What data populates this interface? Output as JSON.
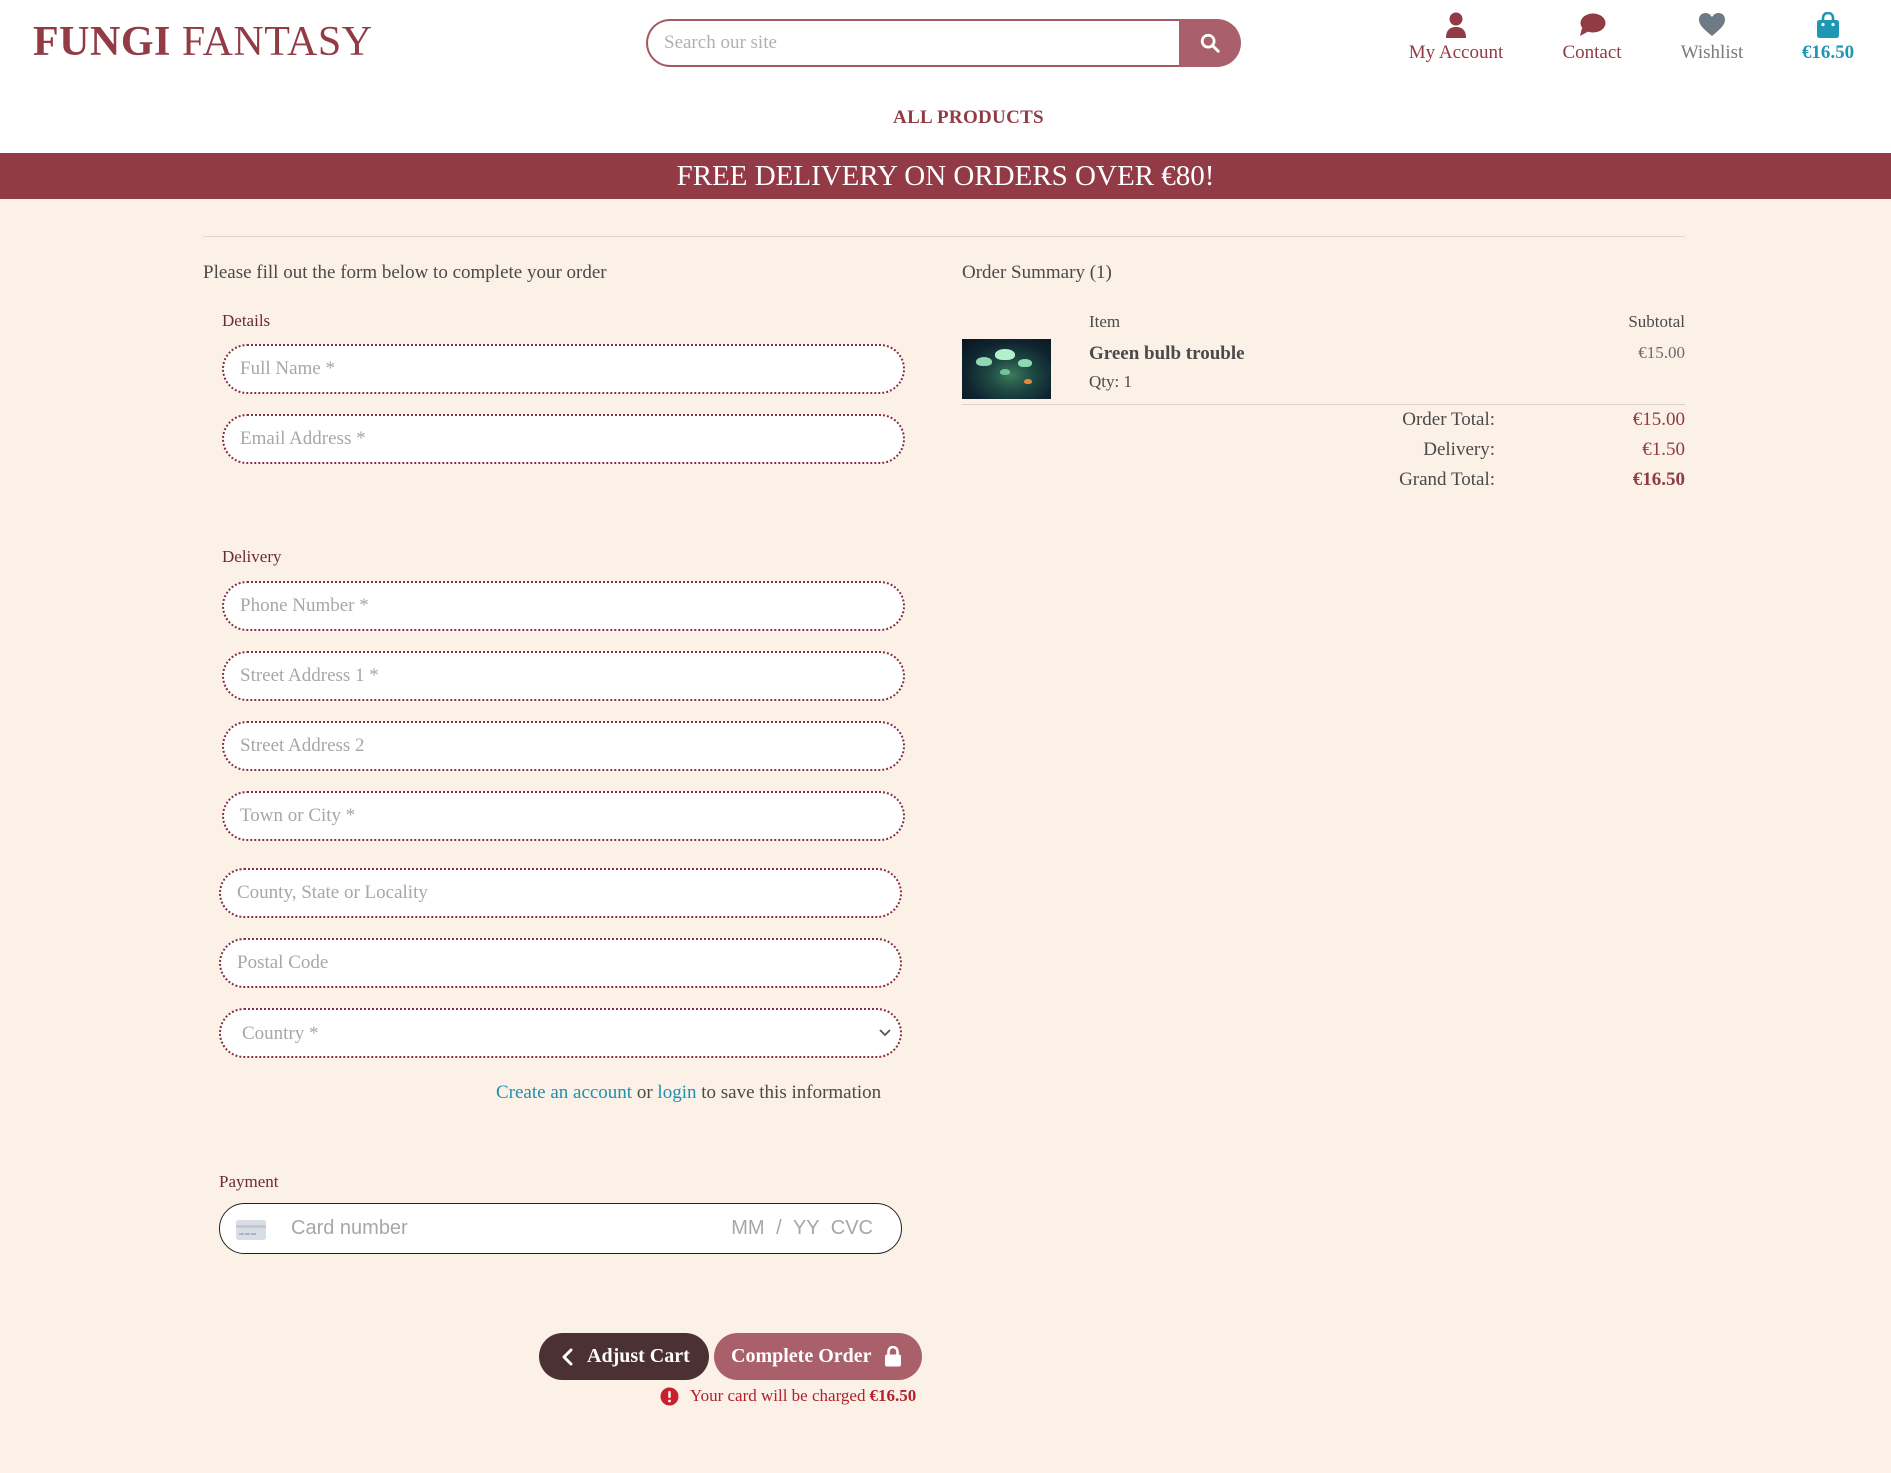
{
  "brand": {
    "name_bold": "FUNGI",
    "name_rest": "FANTASY"
  },
  "search": {
    "placeholder": "Search our site"
  },
  "nav": {
    "my_account": "My Account",
    "contact": "Contact",
    "wishlist": "Wishlist",
    "cart_total": "€16.50",
    "all_products": "ALL PRODUCTS"
  },
  "banner": {
    "text": "FREE DELIVERY ON ORDERS OVER €80!"
  },
  "form": {
    "intro": "Please fill out the form below to complete your order",
    "details_label": "Details",
    "full_name_placeholder": "Full Name *",
    "email_placeholder": "Email Address *",
    "delivery_label": "Delivery",
    "phone_placeholder": "Phone Number *",
    "street1_placeholder": "Street Address 1 *",
    "street2_placeholder": "Street Address 2",
    "town_placeholder": "Town or City *",
    "county_placeholder": "County, State or Locality",
    "postcode_placeholder": "Postal Code",
    "country_selected": "Country *",
    "save_create_account": "Create an account",
    "save_or": "or",
    "save_login": "login",
    "save_suffix": "to save this information",
    "payment_label": "Payment",
    "card_number_placeholder": "Card number",
    "card_expiry_cvc_placeholder": "MM / YY  CVC"
  },
  "actions": {
    "adjust_cart": "Adjust Cart",
    "complete_order": "Complete Order",
    "charge_note": "Your card will be charged",
    "charge_amount": "€16.50"
  },
  "summary": {
    "title": "Order Summary (1)",
    "col_item": "Item",
    "col_subtotal": "Subtotal",
    "items": [
      {
        "name": "Green bulb trouble",
        "qty": "Qty: 1",
        "subtotal": "€15.00"
      }
    ],
    "order_total_label": "Order Total:",
    "order_total": "€15.00",
    "delivery_label": "Delivery:",
    "delivery": "€1.50",
    "grand_total_label": "Grand Total:",
    "grand_total": "€16.50"
  },
  "colors": {
    "brand": "#913b45",
    "banner": "#923b46",
    "button_primary": "#a9606a",
    "button_dark": "#4b3133",
    "link": "#1e8fb0",
    "background": "#fcf1e6"
  }
}
